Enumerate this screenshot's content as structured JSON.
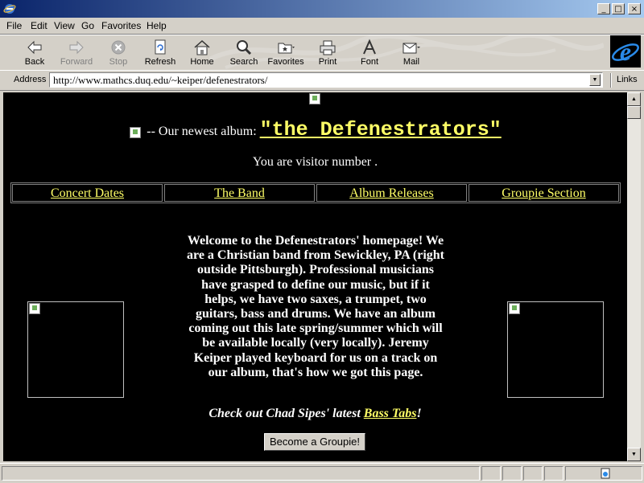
{
  "menu": {
    "items": [
      {
        "label": "File"
      },
      {
        "label": "Edit"
      },
      {
        "label": "View"
      },
      {
        "label": "Go"
      },
      {
        "label": "Favorites"
      },
      {
        "label": "Help"
      }
    ]
  },
  "window_controls": {
    "minimize": "_",
    "maximize": "□",
    "close": "×"
  },
  "toolbar": {
    "buttons": [
      {
        "label": "Back",
        "icon": "back-arrow-icon",
        "enabled": true
      },
      {
        "label": "Forward",
        "icon": "forward-arrow-icon",
        "enabled": false
      },
      {
        "label": "Stop",
        "icon": "stop-icon",
        "enabled": false
      },
      {
        "label": "Refresh",
        "icon": "refresh-icon",
        "enabled": true
      },
      {
        "label": "Home",
        "icon": "home-icon",
        "enabled": true
      },
      {
        "label": "Search",
        "icon": "search-icon",
        "enabled": true
      },
      {
        "label": "Favorites",
        "icon": "favorites-folder-icon",
        "enabled": true
      },
      {
        "label": "Print",
        "icon": "printer-icon",
        "enabled": true
      },
      {
        "label": "Font",
        "icon": "font-icon",
        "enabled": true
      },
      {
        "label": "Mail",
        "icon": "mail-icon",
        "enabled": true
      }
    ]
  },
  "address": {
    "label": "Address",
    "url": "http://www.mathcs.duq.edu/~keiper/defenestrators/",
    "links_label": "Links"
  },
  "page": {
    "album_prefix": "-- Our newest album:",
    "album_title": "\"the Defenestrators\"",
    "visitor_text": "You are visitor number .",
    "nav": [
      "Concert Dates",
      "The Band",
      "Album Releases",
      "Groupie Section"
    ],
    "welcome": "Welcome to the Defenestrators' homepage! We are a Christian band from Sewickley, PA (right outside Pittsburgh). Professional musicians have grasped to define our music, but if it helps, we have two saxes, a trumpet, two guitars, bass and drums. We have an album coming out this late spring/summer which will be available locally (very locally). Jeremy Keiper played keyboard for us on a track on our album, that's how we got this page.",
    "bass_prefix": "Check out Chad Sipes' latest ",
    "bass_link": "Bass Tabs",
    "bass_suffix": "!",
    "groupie_button": "Become a Groupie!"
  },
  "colors": {
    "link": "#ffff66",
    "page_background": "#000000",
    "chrome": "#d4d0c8",
    "titlebar_start": "#0a246a",
    "titlebar_end": "#a6caf0"
  }
}
